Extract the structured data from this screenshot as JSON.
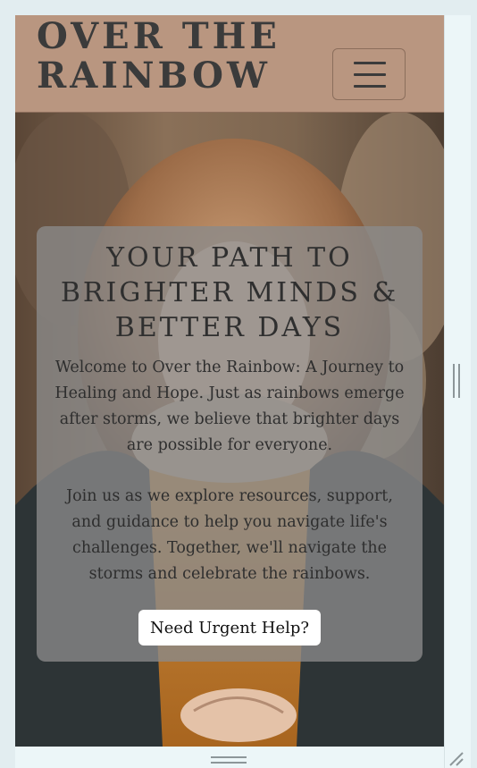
{
  "header": {
    "site_title": "OVER THE\nRAINBOW",
    "menu_icon": "hamburger-menu-icon"
  },
  "hero": {
    "heading": "YOUR PATH TO BRIGHTER MINDS & BETTER DAYS",
    "paragraph_1": "Welcome to Over the Rainbow: A Journey to Healing and Hope. Just as rainbows emerge after storms, we believe that brighter days are possible for everyone.",
    "paragraph_2": "Join us as we explore resources, support, and guidance to help you navigate life's challenges. Together, we'll navigate the storms and celebrate the rainbows.",
    "urgent_help_label": "Need Urgent Help?"
  },
  "colors": {
    "header_bg": "#b99680",
    "title_text": "#3b3b3b",
    "card_bg": "rgba(138,138,138,0.78)",
    "button_bg": "#ffffff"
  }
}
